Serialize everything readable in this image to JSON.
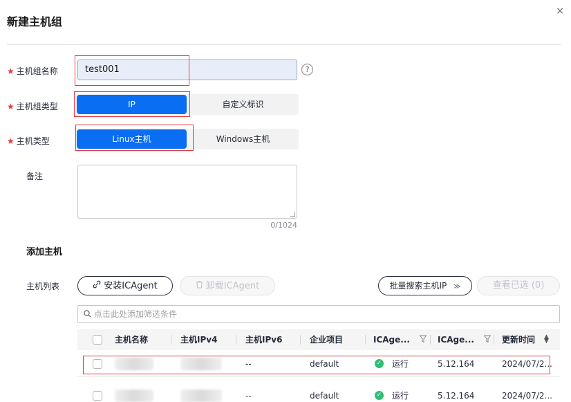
{
  "dialog": {
    "title": "新建主机组",
    "close": "×"
  },
  "form": {
    "name_label": "主机组名称",
    "name_value": "test001",
    "help_icon": "?",
    "group_type_label": "主机组类型",
    "group_type_options": [
      "IP",
      "自定义标识"
    ],
    "group_type_selected": "IP",
    "host_type_label": "主机类型",
    "host_type_options": [
      "Linux主机",
      "Windows主机"
    ],
    "host_type_selected": "Linux主机",
    "remark_label": "备注",
    "remark_value": "",
    "remark_counter": "0/1024",
    "required_mark": "★"
  },
  "add_host": {
    "section_title": "添加主机",
    "list_label": "主机列表",
    "install_button": "安装ICAgent",
    "uninstall_button": "卸载ICAgent",
    "batch_search_button": "批量搜索主机IP",
    "view_selected_button": "查看已选 (0)",
    "search_placeholder": "点击此处添加筛选条件",
    "columns": [
      "主机名称",
      "主机IPv4",
      "主机IPv6",
      "企业项目",
      "ICAge...",
      "ICAge...",
      "更新时间"
    ],
    "rows": [
      {
        "ipv6": "--",
        "project": "default",
        "status": "运行",
        "version": "5.12.164",
        "updated": "2024/07/2..."
      },
      {
        "ipv6": "--",
        "project": "default",
        "status": "运行",
        "version": "5.12.164",
        "updated": "2024/07/2..."
      }
    ]
  },
  "colors": {
    "primary": "#0a6ef2",
    "required": "#e5393f",
    "highlight_box": "#e5393f",
    "status_running": "#2dbf74"
  }
}
